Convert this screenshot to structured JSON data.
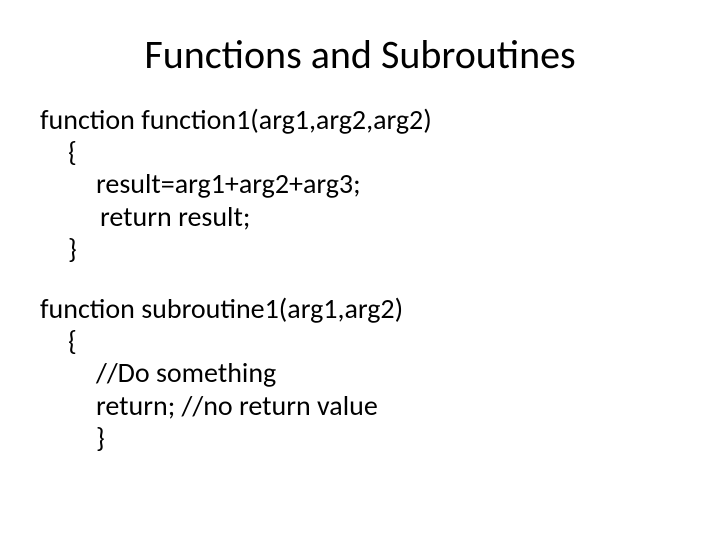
{
  "title": "Functions and Subroutines",
  "func": {
    "sig": "function function1(arg1,arg2,arg2)",
    "open": "{",
    "body1": "result=arg1+arg2+arg3;",
    "body2": "return result;",
    "close": "}"
  },
  "sub": {
    "sig": "function subroutine1(arg1,arg2)",
    "open": "{",
    "body1": "//Do something",
    "body2": "return;   //no return value",
    "close": "}"
  }
}
